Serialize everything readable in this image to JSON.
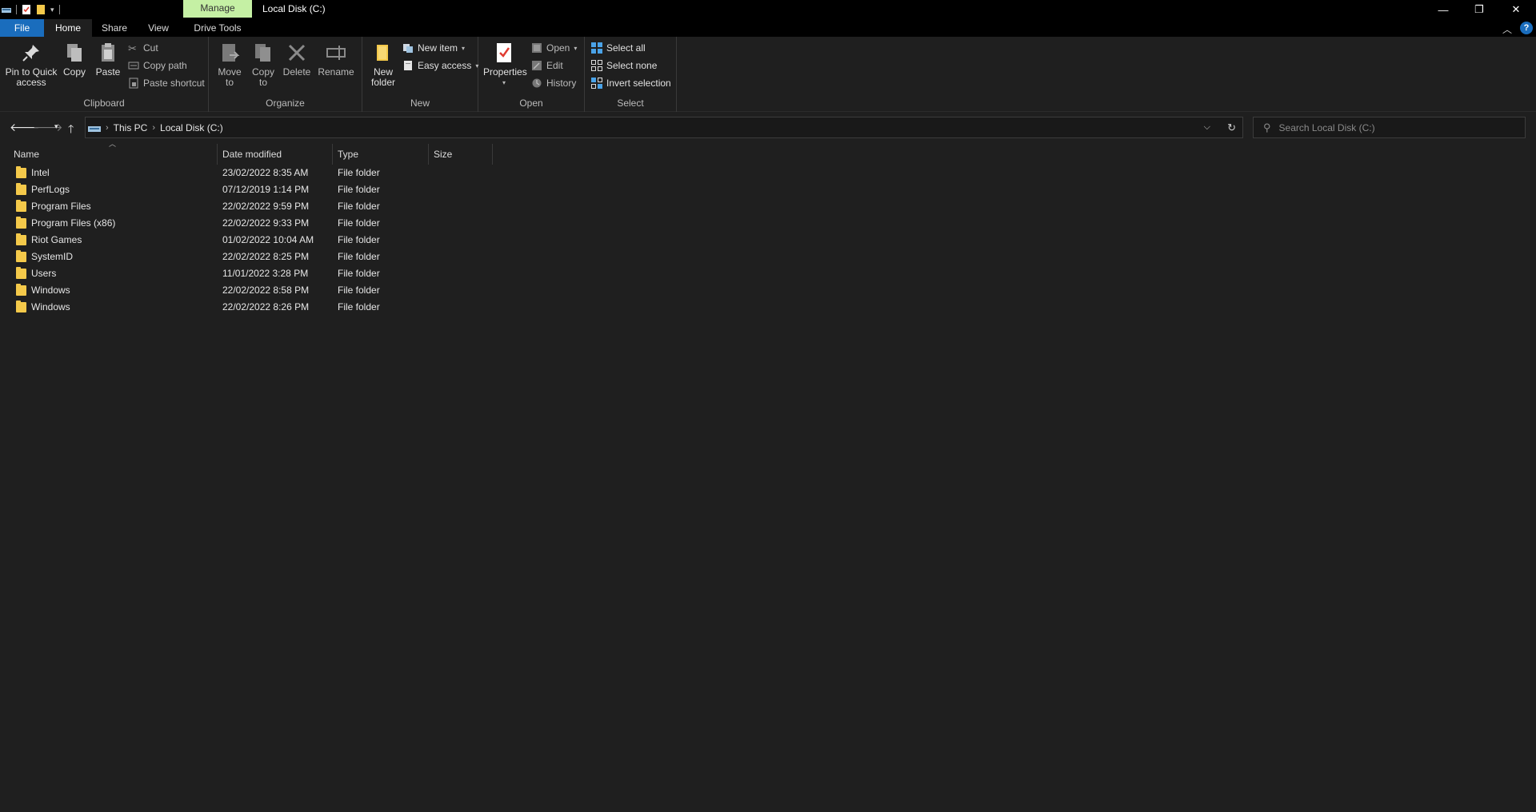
{
  "window": {
    "title": "Local Disk (C:)",
    "context_tab": "Manage",
    "controls": {
      "minimize": "—",
      "restore": "❐",
      "close": "✕"
    }
  },
  "tabs": [
    {
      "label": "File"
    },
    {
      "label": "Home"
    },
    {
      "label": "Share"
    },
    {
      "label": "View"
    },
    {
      "label": "Drive Tools"
    }
  ],
  "ribbon": {
    "clipboard": {
      "label": "Clipboard",
      "pin": "Pin to Quick access",
      "copy": "Copy",
      "paste": "Paste",
      "cut": "Cut",
      "copy_path": "Copy path",
      "paste_shortcut": "Paste shortcut"
    },
    "organize": {
      "label": "Organize",
      "move_to": "Move to",
      "copy_to": "Copy to",
      "delete": "Delete",
      "rename": "Rename"
    },
    "new": {
      "label": "New",
      "new_folder": "New folder",
      "new_item": "New item",
      "easy_access": "Easy access"
    },
    "open": {
      "label": "Open",
      "properties": "Properties",
      "open": "Open",
      "edit": "Edit",
      "history": "History"
    },
    "select": {
      "label": "Select",
      "select_all": "Select all",
      "select_none": "Select none",
      "invert_selection": "Invert selection"
    }
  },
  "address": {
    "breadcrumbs": [
      "This PC",
      "Local Disk (C:)"
    ]
  },
  "search": {
    "placeholder": "Search Local Disk (C:)"
  },
  "columns": {
    "name": "Name",
    "date": "Date modified",
    "type": "Type",
    "size": "Size"
  },
  "files": [
    {
      "name": "Intel",
      "date": "23/02/2022 8:35 AM",
      "type": "File folder"
    },
    {
      "name": "PerfLogs",
      "date": "07/12/2019 1:14 PM",
      "type": "File folder"
    },
    {
      "name": "Program Files",
      "date": "22/02/2022 9:59 PM",
      "type": "File folder"
    },
    {
      "name": "Program Files (x86)",
      "date": "22/02/2022 9:33 PM",
      "type": "File folder"
    },
    {
      "name": "Riot Games",
      "date": "01/02/2022 10:04 AM",
      "type": "File folder"
    },
    {
      "name": "SystemID",
      "date": "22/02/2022 8:25 PM",
      "type": "File folder"
    },
    {
      "name": "Users",
      "date": "11/01/2022 3:28 PM",
      "type": "File folder"
    },
    {
      "name": "Windows",
      "date": "22/02/2022 8:58 PM",
      "type": "File folder"
    },
    {
      "name": "Windows",
      "date": "22/02/2022 8:26 PM",
      "type": "File folder"
    }
  ],
  "colors": {
    "accent": "#1a6dbd",
    "manage_tab": "#c5f0a4",
    "folder": "#f4c94a",
    "background": "#1f1f1f"
  }
}
